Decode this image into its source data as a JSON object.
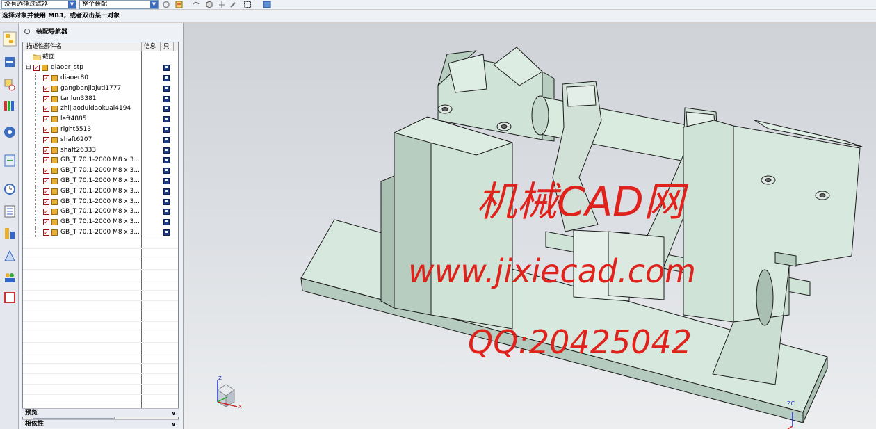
{
  "toolbar": {
    "filter_value": "没有选择过滤器",
    "assembly_value": "整个装配"
  },
  "status": {
    "message": "选择对象并使用 MB3，或者双击某一对象"
  },
  "navigator": {
    "title": "装配导航器",
    "columns": {
      "name": "描述性部件名",
      "info": "信息",
      "readonly": "只"
    },
    "section_folder": "截面",
    "root": "diaoer_stp",
    "parts": [
      "diaoer80",
      "gangbanjiajuti1777",
      "tanlun3381",
      "zhijiaoduidaokuai4194",
      "left4885",
      "right5513",
      "shaft6207",
      "shaft26333",
      "GB_T 70.1-2000 M8 x 3...",
      "GB_T 70.1-2000 M8 x 3...",
      "GB_T 70.1-2000 M8 x 3...",
      "GB_T 70.1-2000 M8 x 3...",
      "GB_T 70.1-2000 M8 x 3...",
      "GB_T 70.1-2000 M8 x 3...",
      "GB_T 70.1-2000 M8 x 3...",
      "GB_T 70.1-2000 M8 x 3..."
    ],
    "preview_label": "预览",
    "dependents_label": "相依性"
  },
  "viewport": {
    "watermark_line1": "机械CAD网",
    "watermark_line2": "www.jixiecad.com",
    "watermark_line3": "QQ:20425042",
    "triad_z": "Z",
    "triad_x": "X",
    "corner_zc": "ZC"
  },
  "colors": {
    "model_face": "#c9ddd3",
    "model_edge": "#1a1a1a",
    "watermark": "#e0221c",
    "accent": "#3d6dbf"
  }
}
